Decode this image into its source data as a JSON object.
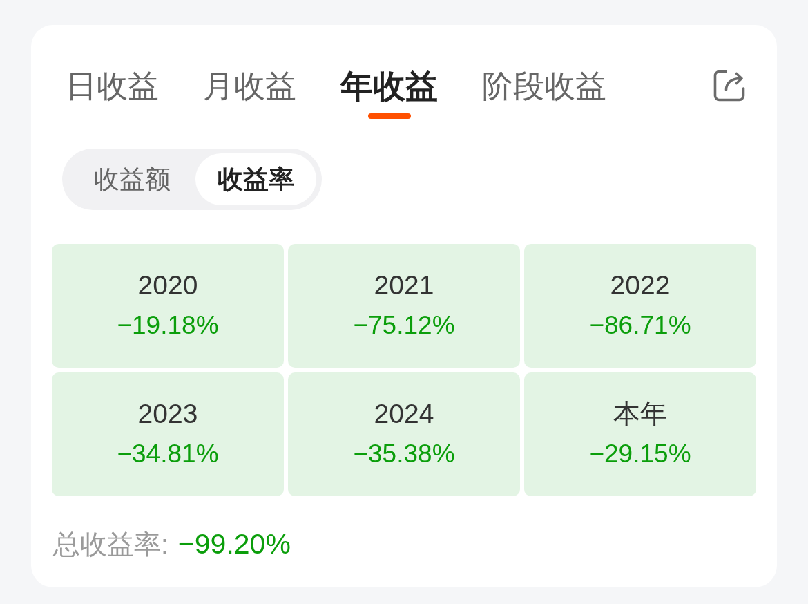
{
  "tabs": [
    {
      "label": "日收益",
      "selected": false
    },
    {
      "label": "月收益",
      "selected": false
    },
    {
      "label": "年收益",
      "selected": true
    },
    {
      "label": "阶段收益",
      "selected": false
    }
  ],
  "metric_toggle": [
    {
      "label": "收益额",
      "selected": false
    },
    {
      "label": "收益率",
      "selected": true
    }
  ],
  "years": [
    {
      "label": "2020",
      "value": "−19.18%"
    },
    {
      "label": "2021",
      "value": "−75.12%"
    },
    {
      "label": "2022",
      "value": "−86.71%"
    },
    {
      "label": "2023",
      "value": "−34.81%"
    },
    {
      "label": "2024",
      "value": "−35.38%"
    },
    {
      "label": "本年",
      "value": "−29.15%"
    }
  ],
  "total": {
    "label": "总收益率:",
    "value": "−99.20%"
  }
}
